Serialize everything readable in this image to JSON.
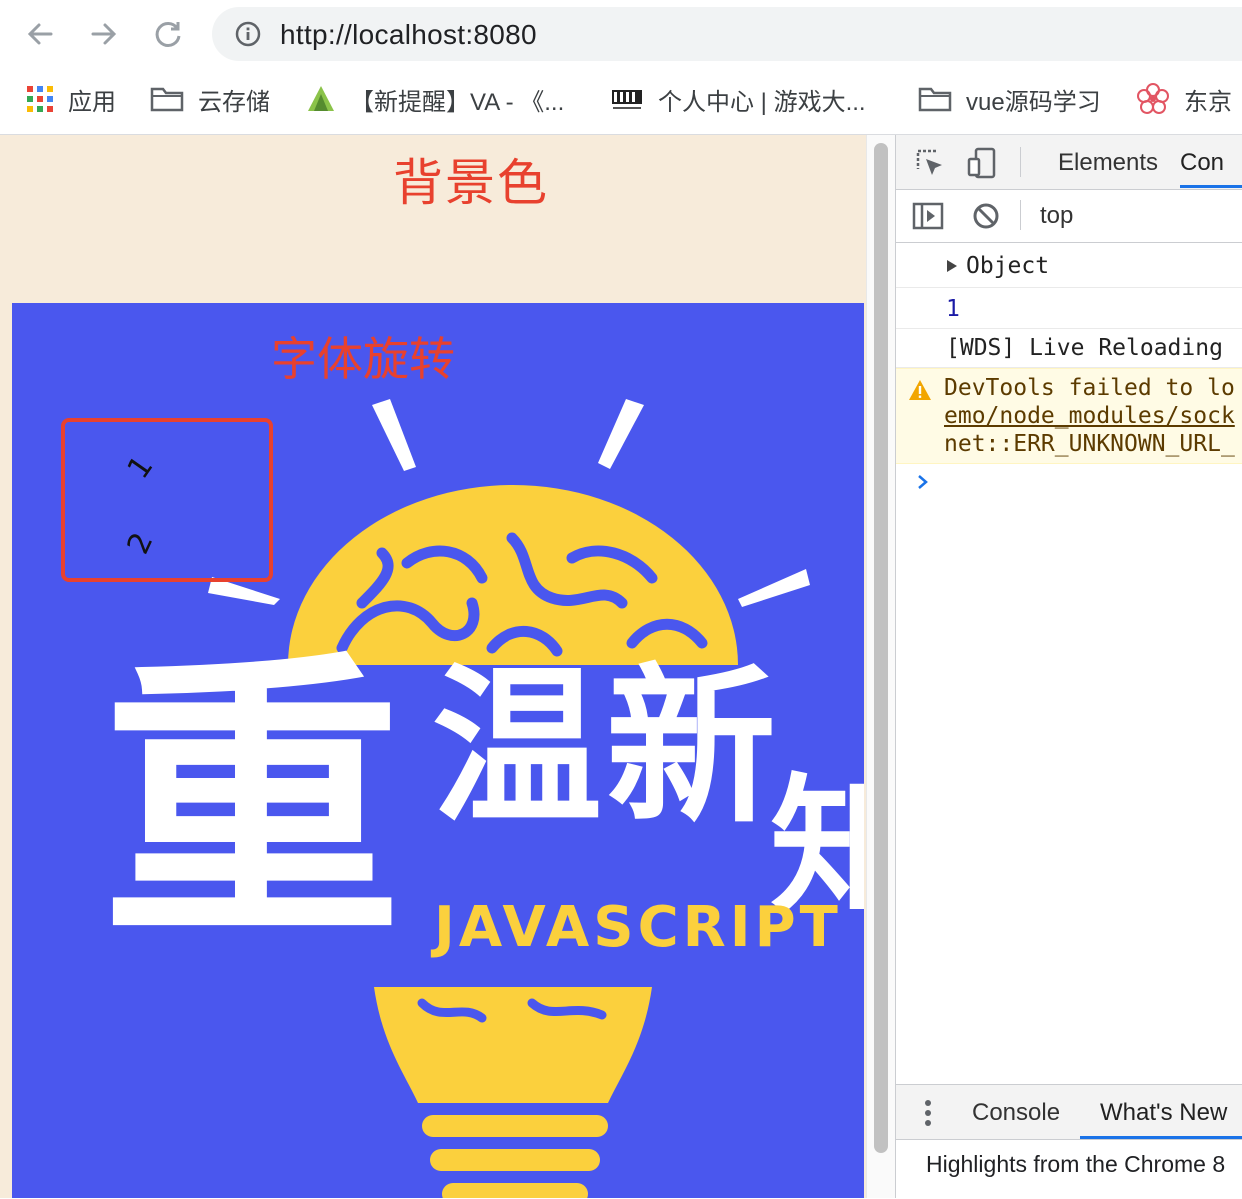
{
  "browser": {
    "url": "http://localhost:8080",
    "bookmarks": [
      {
        "label": "应用",
        "icon": "apps-grid-icon"
      },
      {
        "label": "云存储",
        "icon": "folder-icon"
      },
      {
        "label": "【新提醒】VA - 《...",
        "icon": "site-favicon-icon"
      },
      {
        "label": "个人中心 | 游戏大...",
        "icon": "site-favicon-icon"
      },
      {
        "label": "vue源码学习",
        "icon": "folder-icon"
      },
      {
        "label": "东京",
        "icon": "flower-icon"
      }
    ]
  },
  "page": {
    "background_title": "背景色",
    "rotate_title": "字体旋转",
    "rotated_numbers": [
      "1",
      "2"
    ],
    "poster": {
      "chars": [
        "重",
        "温",
        "新",
        "知"
      ],
      "subtitle": "JAVASCRIPT"
    },
    "colors": {
      "page_bg": "#f7ebda",
      "poster_bg": "#4a57ee",
      "accent_red": "#e8412e",
      "accent_yellow": "#fbd03d"
    }
  },
  "devtools": {
    "tabs": [
      "Elements",
      "Con"
    ],
    "context": "top",
    "logs": [
      {
        "type": "object",
        "text": "Object"
      },
      {
        "type": "number",
        "text": "1"
      },
      {
        "type": "log",
        "text": "[WDS] Live Reloading"
      },
      {
        "type": "warning",
        "lines": [
          "DevTools failed to lo",
          "emo/node_modules/sock",
          "net::ERR_UNKNOWN_URL_"
        ]
      }
    ],
    "drawer": {
      "tabs": [
        "Console",
        "What's New"
      ],
      "highlight_text": "Highlights from the Chrome 8"
    }
  }
}
